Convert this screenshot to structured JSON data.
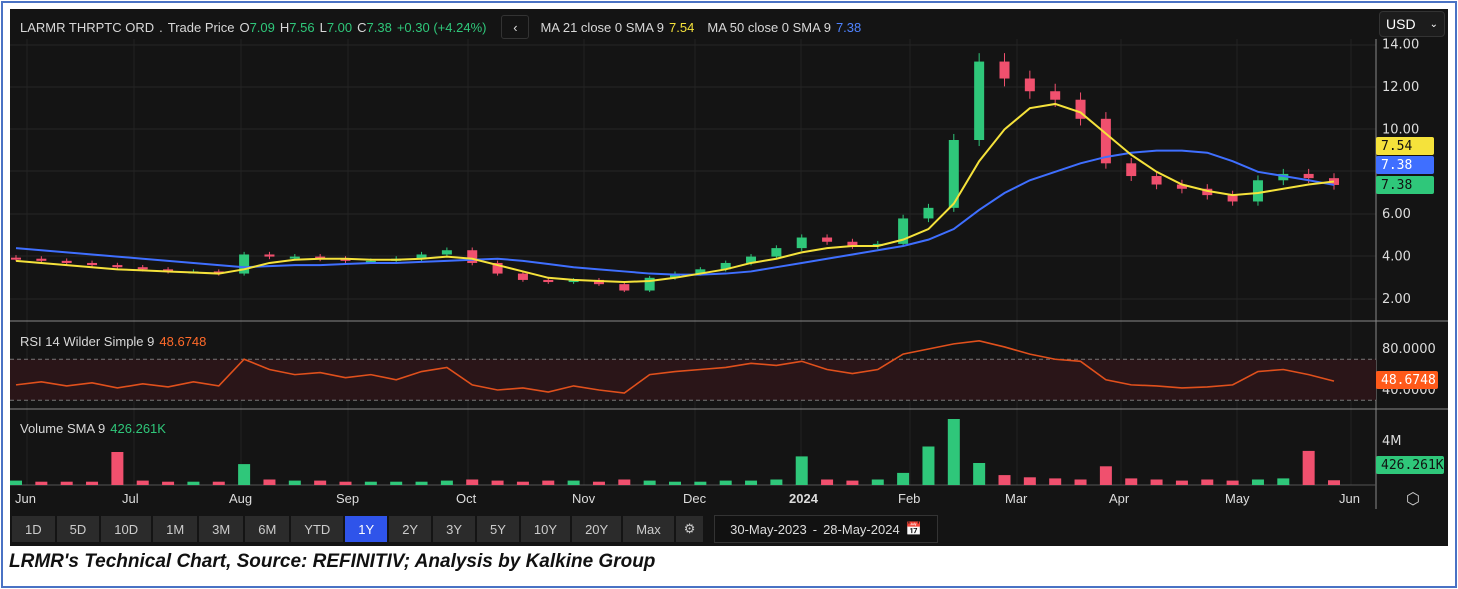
{
  "header": {
    "symbol": "LARMR THRPTC ORD",
    "separator": ".",
    "field": "Trade Price",
    "o_label": "O",
    "o": "7.09",
    "h_label": "H",
    "h": "7.56",
    "l_label": "L",
    "l": "7.00",
    "c_label": "C",
    "c": "7.38",
    "change": "+0.30 (+4.24%)",
    "ma21_label": "MA 21 close 0 SMA 9",
    "ma21_value": "7.54",
    "ma50_label": "MA 50 close 0 SMA 9",
    "ma50_value": "7.38"
  },
  "currency": "USD",
  "rsi": {
    "label": "RSI 14 Wilder Simple 9",
    "value": "48.6748"
  },
  "volume": {
    "label": "Volume SMA 9",
    "value": "426.261K"
  },
  "tags": {
    "ma21": "7.54",
    "ma50": "7.38",
    "close": "7.38",
    "rsi": "48.6748",
    "volume": "426.261K"
  },
  "ranges": [
    "1D",
    "5D",
    "10D",
    "1M",
    "3M",
    "6M",
    "YTD",
    "1Y",
    "2Y",
    "3Y",
    "5Y",
    "10Y",
    "20Y",
    "Max"
  ],
  "active_range": "1Y",
  "date_from": "30-May-2023",
  "date_sep": "-",
  "date_to": "28-May-2024",
  "caption": "LRMR's Technical Chart, Source: REFINITIV; Analysis by Kalkine Group",
  "colors": {
    "up": "#2fc77a",
    "down": "#f0506e",
    "ma21": "#f5e23b",
    "ma50": "#3f6fff",
    "rsi": "#e0501c",
    "active": "#2f54ea"
  },
  "chart_data": {
    "type": "candlestick",
    "period": "weekly",
    "x_ticks": [
      "Jun",
      "Jul",
      "Aug",
      "Sep",
      "Oct",
      "Nov",
      "Dec",
      "2024",
      "Feb",
      "Mar",
      "Apr",
      "May",
      "Jun"
    ],
    "price_ticks": [
      "14.00",
      "12.00",
      "10.00",
      "6.00",
      "4.00",
      "2.00"
    ],
    "price_ylim": [
      1,
      14.5
    ],
    "close": [
      3.9,
      3.8,
      3.7,
      3.6,
      3.5,
      3.4,
      3.3,
      3.3,
      3.2,
      4.1,
      4.0,
      4.0,
      3.9,
      3.8,
      3.8,
      3.9,
      4.1,
      4.3,
      3.7,
      3.2,
      2.9,
      2.8,
      2.9,
      2.7,
      2.4,
      3.0,
      3.2,
      3.4,
      3.7,
      4.0,
      4.4,
      4.9,
      4.7,
      4.5,
      4.6,
      5.8,
      6.3,
      9.5,
      13.2,
      12.4,
      11.8,
      11.4,
      10.5,
      8.4,
      7.8,
      7.4,
      7.2,
      6.9,
      6.6,
      7.6,
      7.9,
      7.7,
      7.38
    ],
    "ma21": [
      3.8,
      3.7,
      3.6,
      3.5,
      3.4,
      3.35,
      3.3,
      3.25,
      3.2,
      3.4,
      3.7,
      3.85,
      3.9,
      3.9,
      3.85,
      3.85,
      3.9,
      4.0,
      3.9,
      3.6,
      3.3,
      3.0,
      2.9,
      2.85,
      2.8,
      2.85,
      3.0,
      3.2,
      3.4,
      3.7,
      3.9,
      4.2,
      4.4,
      4.5,
      4.5,
      4.8,
      5.3,
      6.5,
      8.5,
      10.0,
      11.0,
      11.2,
      10.8,
      9.8,
      8.8,
      8.0,
      7.4,
      7.1,
      6.9,
      7.0,
      7.2,
      7.4,
      7.54
    ],
    "ma50": [
      4.4,
      4.3,
      4.2,
      4.1,
      4.0,
      3.9,
      3.8,
      3.7,
      3.6,
      3.5,
      3.55,
      3.6,
      3.6,
      3.65,
      3.7,
      3.7,
      3.75,
      3.8,
      3.85,
      3.9,
      3.8,
      3.65,
      3.5,
      3.4,
      3.3,
      3.2,
      3.15,
      3.15,
      3.2,
      3.3,
      3.5,
      3.7,
      3.9,
      4.1,
      4.3,
      4.5,
      4.8,
      5.3,
      6.2,
      7.0,
      7.6,
      8.0,
      8.4,
      8.7,
      8.9,
      9.0,
      9.0,
      8.9,
      8.5,
      8.0,
      7.8,
      7.6,
      7.38
    ],
    "rsi_ticks": [
      "80.0000",
      "40.0000"
    ],
    "rsi_bands": [
      70,
      30
    ],
    "rsi": [
      45,
      48,
      44,
      47,
      42,
      46,
      43,
      48,
      44,
      70,
      60,
      55,
      57,
      52,
      55,
      50,
      58,
      62,
      45,
      40,
      42,
      38,
      44,
      40,
      37,
      55,
      58,
      60,
      62,
      66,
      64,
      68,
      60,
      56,
      60,
      75,
      80,
      85,
      88,
      82,
      75,
      70,
      68,
      50,
      45,
      44,
      42,
      43,
      45,
      58,
      60,
      55,
      48.67
    ],
    "volume_ticks": [
      "4M"
    ],
    "volume_millions": [
      0.4,
      0.3,
      0.3,
      0.3,
      3.0,
      0.4,
      0.3,
      0.3,
      0.3,
      1.9,
      0.5,
      0.4,
      0.4,
      0.3,
      0.3,
      0.3,
      0.3,
      0.4,
      0.5,
      0.4,
      0.3,
      0.4,
      0.4,
      0.3,
      0.5,
      0.4,
      0.3,
      0.3,
      0.4,
      0.4,
      0.5,
      2.6,
      0.5,
      0.4,
      0.5,
      1.1,
      3.5,
      6.0,
      2.0,
      0.9,
      0.7,
      0.6,
      0.5,
      1.7,
      0.6,
      0.5,
      0.4,
      0.5,
      0.4,
      0.5,
      0.6,
      3.1,
      0.43
    ]
  }
}
